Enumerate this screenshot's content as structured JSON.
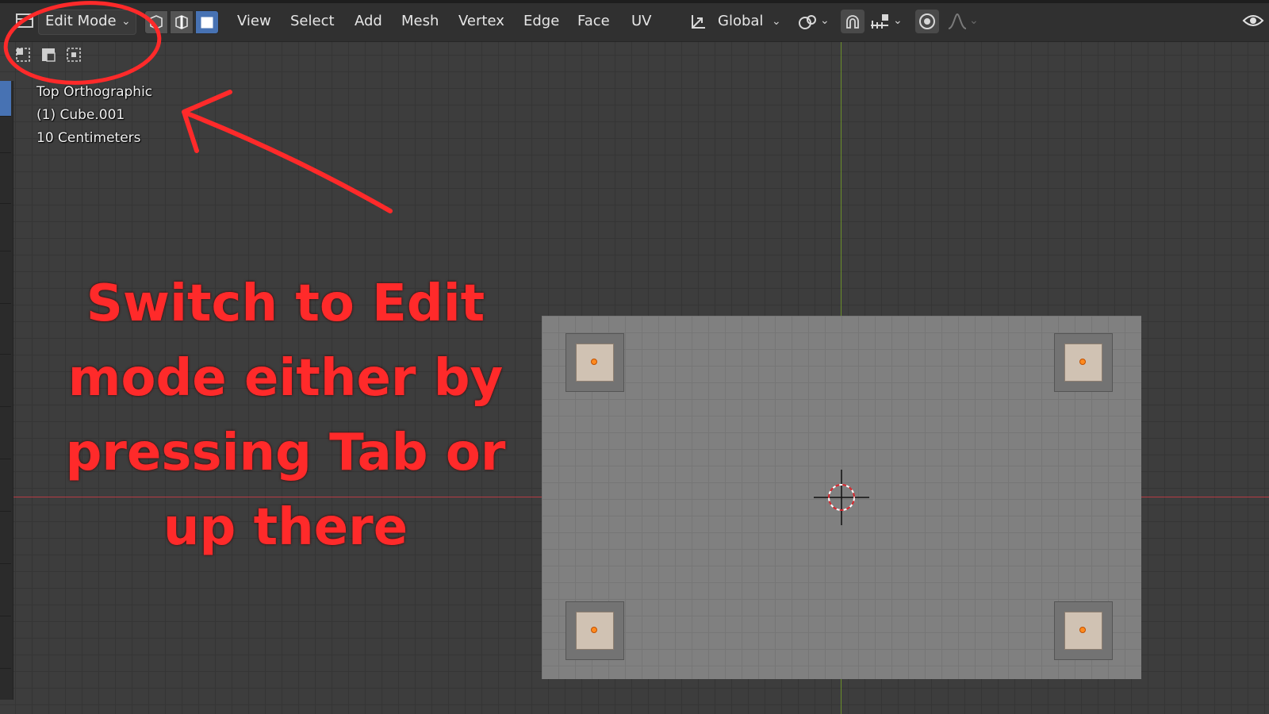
{
  "header": {
    "mode_dropdown": "Edit Mode",
    "menu": [
      "View",
      "Select",
      "Add",
      "Mesh",
      "Vertex",
      "Edge",
      "Face",
      "UV"
    ],
    "transform_orientation": "Global"
  },
  "viewport_overlay": {
    "view_name": "Top Orthographic",
    "object_name": "(1) Cube.001",
    "scale": "10 Centimeters"
  },
  "annotation": {
    "text": "Switch to Edit mode either by pressing Tab or up there",
    "color": "#ff2a2a"
  },
  "icons": {
    "editor_type": "editor-type-icon",
    "vertex_select": "vertex-select-icon",
    "edge_select": "edge-select-icon",
    "face_select": "face-select-icon",
    "transform_orientation": "transform-orientation-icon",
    "pivot": "pivot-point-icon",
    "snap": "snap-magnet-icon",
    "snap_increment": "snap-increment-icon",
    "proportional": "proportional-edit-icon",
    "falloff": "falloff-curve-icon",
    "visibility": "visibility-eye-icon"
  },
  "colors": {
    "active_select_mode": "#4772b3",
    "x_axis": "#b63a44",
    "y_axis": "#6a8f2a",
    "vertex": "#ff8a1e"
  }
}
